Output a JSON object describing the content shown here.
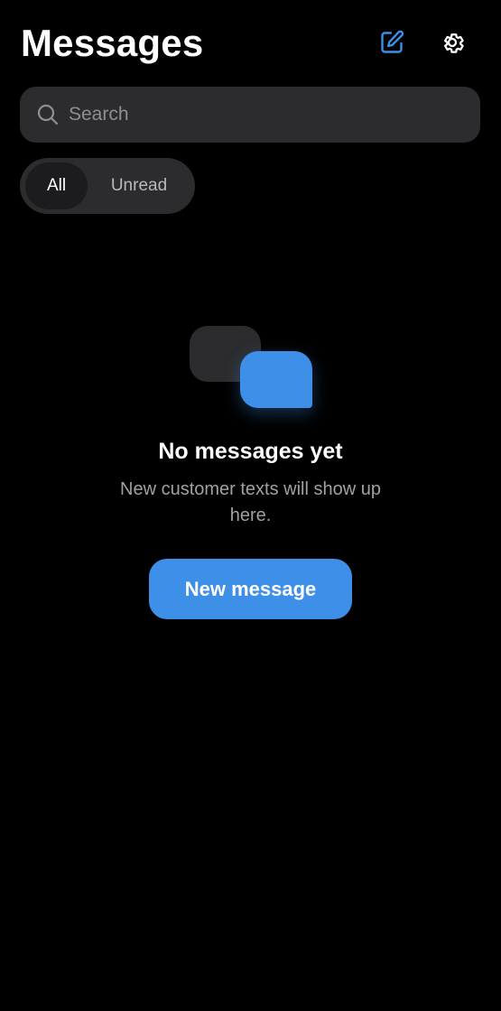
{
  "header": {
    "title": "Messages",
    "compose_icon": "compose-icon",
    "settings_icon": "gear-icon"
  },
  "search": {
    "placeholder": "Search",
    "value": "",
    "icon": "search-icon"
  },
  "filter": {
    "options": [
      "All",
      "Unread"
    ],
    "selected": "All"
  },
  "empty_state": {
    "title": "No messages yet",
    "subtitle": "New customer texts will show up here.",
    "button_label": "New message",
    "illustration": "chat-bubbles-icon"
  },
  "colors": {
    "background": "#000000",
    "accent": "#3d8fe8",
    "surface": "#2c2c2e",
    "selected_segment": "#1c1c1e",
    "muted_text": "#a0a0a5"
  }
}
